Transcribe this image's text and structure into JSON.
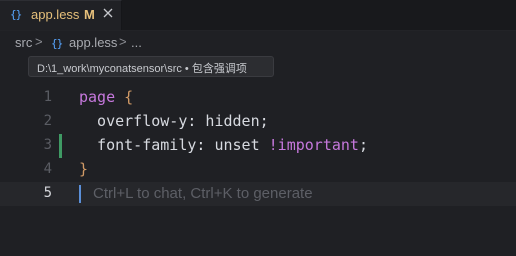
{
  "tab": {
    "icon": "{}",
    "label": "app.less",
    "modified": "M"
  },
  "breadcrumb": {
    "folder": "src",
    "separator": ">",
    "icon": "{}",
    "file": "app.less",
    "more": "..."
  },
  "tooltip": {
    "text": "D:\\1_work\\myconatsensor\\src • 包含强调项"
  },
  "editor": {
    "line_numbers": [
      "1",
      "2",
      "3",
      "4",
      "5"
    ],
    "active_line": "5",
    "lines": {
      "l1": {
        "selector": "page",
        "brace": " {"
      },
      "l2": {
        "text": "  overflow-y: hidden;"
      },
      "l3": {
        "prop": "  font-family: unset ",
        "important": "!important",
        "end": ";"
      },
      "l4": {
        "brace": "}"
      }
    },
    "inline_hint": "Ctrl+L to chat, Ctrl+K to generate"
  },
  "colors": {
    "background": "#1f2024",
    "selector": "#c678dd",
    "brace": "#d19a66",
    "modified_tab": "#e6c07b",
    "git_added_marker": "#3f9a64",
    "cursor": "#5b8fd8"
  },
  "icons": {
    "tab_file_icon": "braces-icon",
    "tab_close": "close-icon",
    "breadcrumb_file_icon": "braces-icon"
  }
}
